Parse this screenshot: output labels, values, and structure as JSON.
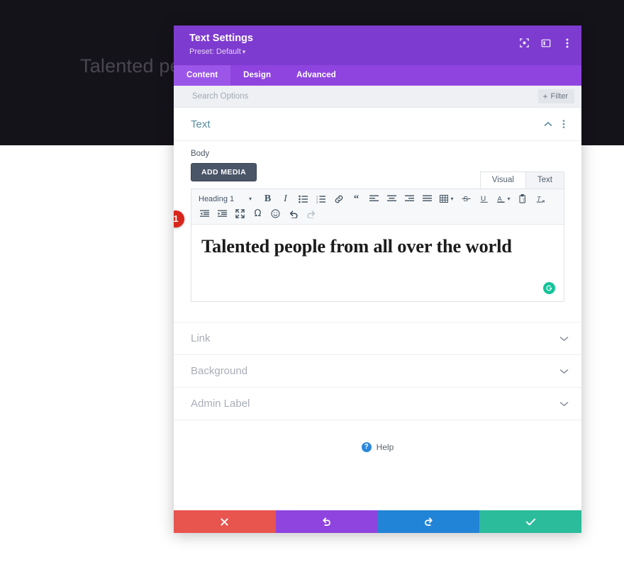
{
  "backdrop": {
    "hero_heading": "Talented people from all over the world"
  },
  "modal": {
    "title": "Text Settings",
    "preset_label": "Preset: Default",
    "preset_caret": "▾",
    "header_icons": [
      {
        "name": "focus-target-icon",
        "title": "Focus"
      },
      {
        "name": "panel-layout-icon",
        "title": "Layout"
      },
      {
        "name": "more-vertical-icon",
        "title": "More options"
      }
    ],
    "tabs": [
      {
        "label": "Content",
        "active": true
      },
      {
        "label": "Design",
        "active": false
      },
      {
        "label": "Advanced",
        "active": false
      }
    ],
    "search": {
      "placeholder": "Search Options",
      "value": "",
      "filter_label": "Filter",
      "filter_plus": "+"
    }
  },
  "text_section": {
    "title": "Text",
    "collapse_icon": "chevron-up-icon",
    "menu_icon": "more-vertical-icon",
    "body_label": "Body",
    "add_media_label": "ADD MEDIA",
    "editor_tabs": [
      {
        "label": "Visual",
        "active": true
      },
      {
        "label": "Text",
        "active": false
      }
    ],
    "format_select": {
      "value": "Heading 1",
      "caret": "▾"
    },
    "toolbar_row1": [
      {
        "name": "bold-icon",
        "glyph": "B",
        "disabled": false
      },
      {
        "name": "italic-icon",
        "glyph": "I",
        "disabled": false
      },
      {
        "name": "bulleted-list-icon",
        "glyph": "",
        "disabled": false
      },
      {
        "name": "numbered-list-icon",
        "glyph": "",
        "disabled": false
      },
      {
        "name": "link-icon",
        "glyph": "",
        "disabled": false
      },
      {
        "name": "blockquote-icon",
        "glyph": "“",
        "disabled": false
      },
      {
        "name": "align-left-icon",
        "glyph": "",
        "disabled": false
      },
      {
        "name": "align-center-icon",
        "glyph": "",
        "disabled": false
      },
      {
        "name": "align-right-icon",
        "glyph": "",
        "disabled": false
      },
      {
        "name": "align-justify-icon",
        "glyph": "",
        "disabled": false
      },
      {
        "name": "table-icon",
        "glyph": "",
        "disabled": false
      },
      {
        "name": "strikethrough-icon",
        "glyph": "S",
        "disabled": false
      },
      {
        "name": "underline-icon",
        "glyph": "U",
        "disabled": false
      },
      {
        "name": "text-color-icon",
        "glyph": "A",
        "disabled": false
      },
      {
        "name": "paste-as-text-icon",
        "glyph": "",
        "disabled": false
      },
      {
        "name": "clear-formatting-icon",
        "glyph": "",
        "disabled": false
      }
    ],
    "toolbar_row2": [
      {
        "name": "outdent-icon",
        "glyph": "",
        "disabled": false
      },
      {
        "name": "indent-icon",
        "glyph": "",
        "disabled": false
      },
      {
        "name": "fullscreen-icon",
        "glyph": "",
        "disabled": false
      },
      {
        "name": "special-character-icon",
        "glyph": "Ω",
        "disabled": false
      },
      {
        "name": "emoji-icon",
        "glyph": "",
        "disabled": false
      },
      {
        "name": "undo-icon",
        "glyph": "",
        "disabled": false
      },
      {
        "name": "redo-icon",
        "glyph": "",
        "disabled": true
      }
    ],
    "editor_content": "Talented people from all over the world",
    "grammarly_badge": "grammarly-icon",
    "step_badge": "1"
  },
  "collapsed_sections": [
    {
      "title": "Link",
      "icon": "chevron-down-icon"
    },
    {
      "title": "Background",
      "icon": "chevron-down-icon"
    },
    {
      "title": "Admin Label",
      "icon": "chevron-down-icon"
    }
  ],
  "help": {
    "label": "Help",
    "icon_glyph": "?"
  },
  "footer_buttons": [
    {
      "name": "cancel-button",
      "icon": "close-icon",
      "color": "#e8544e"
    },
    {
      "name": "undo-button",
      "icon": "undo-icon",
      "color": "#8f44df"
    },
    {
      "name": "redo-button",
      "icon": "redo-icon",
      "color": "#2284d6"
    },
    {
      "name": "save-button",
      "icon": "check-icon",
      "color": "#2bbc9b"
    }
  ]
}
